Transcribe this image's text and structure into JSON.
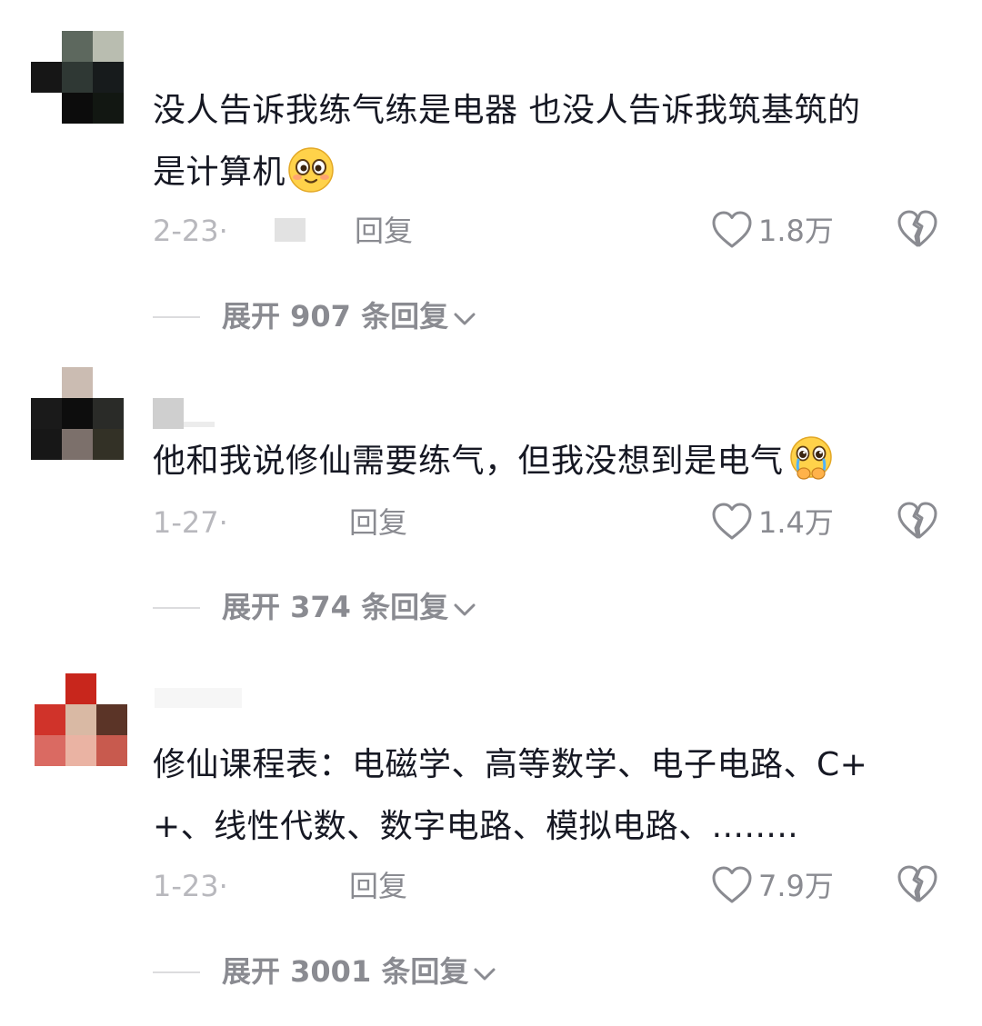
{
  "comments": [
    {
      "content_line1": "没人告诉我练气练是电器 也没人告诉我筑基筑的",
      "content_line2": "是计算机",
      "emoji": "happy-face-emoji",
      "date": "2-23·",
      "reply_label": "回复",
      "likes": "1.8万",
      "expand_text": "展开 907 条回复"
    },
    {
      "content_line1": "他和我说修仙需要练气，但我没想到是电气",
      "emoji": "crying-face-emoji",
      "date": "1-27·",
      "reply_label": "回复",
      "likes": "1.4万",
      "expand_text": "展开 374 条回复"
    },
    {
      "content_line1": "修仙课程表：电磁学、高等数学、电子电路、C+",
      "content_line2": "+、线性代数、数字电路、模拟电路、........",
      "date": "1-23·",
      "reply_label": "回复",
      "likes": "7.9万",
      "expand_text": "展开 3001 条回复"
    }
  ],
  "icons": {
    "like": "heart-outline-icon",
    "dislike": "broken-heart-icon",
    "expand": "chevron-down-icon"
  },
  "colors": {
    "text_primary": "#161823",
    "text_secondary": "#8a8b91",
    "text_date": "#b8b8bd",
    "divider": "#dcdcde"
  }
}
